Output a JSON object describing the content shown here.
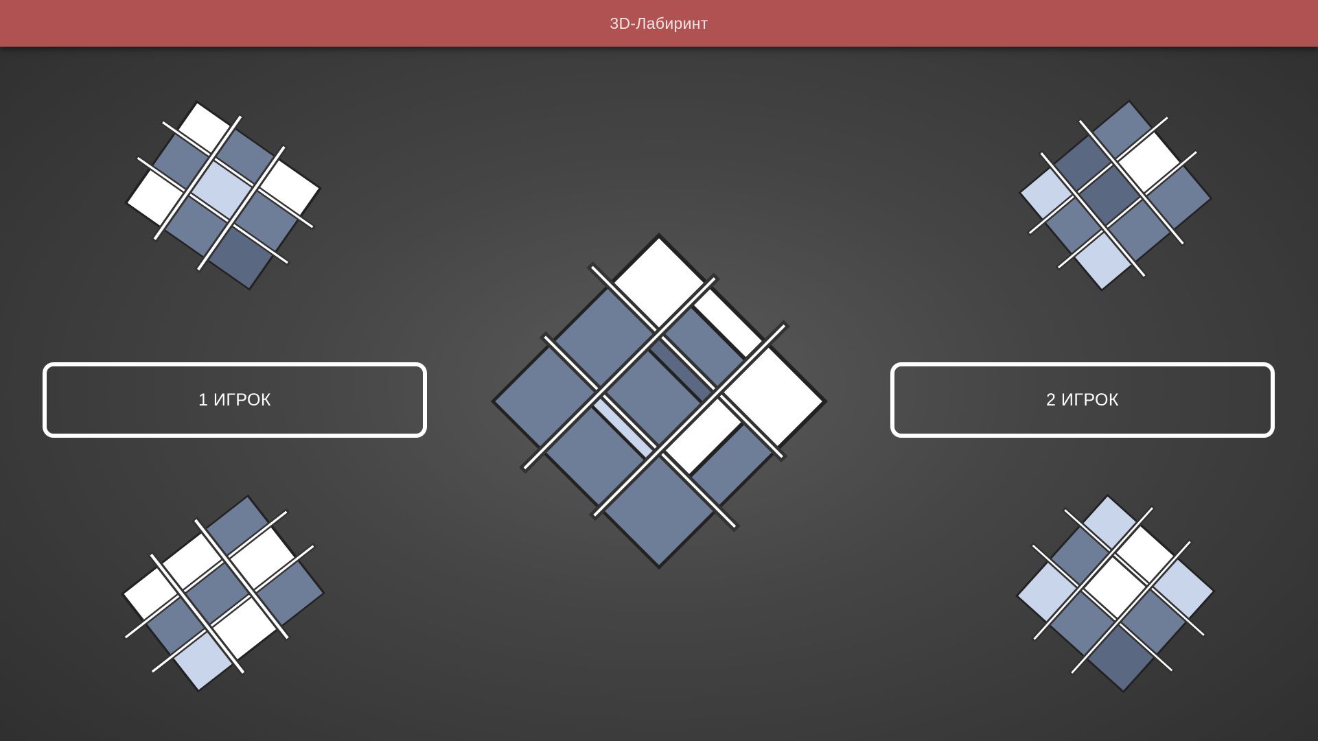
{
  "header": {
    "title": "3D-Лабиринт"
  },
  "menu": {
    "player_one_label": "1 ИГРОК",
    "player_two_label": "2 ИГРОК"
  },
  "colors": {
    "header_bar": "#b05252",
    "button_border": "#ffffff",
    "maze_face": "#6e7e99",
    "maze_wall": "#ffffff"
  }
}
